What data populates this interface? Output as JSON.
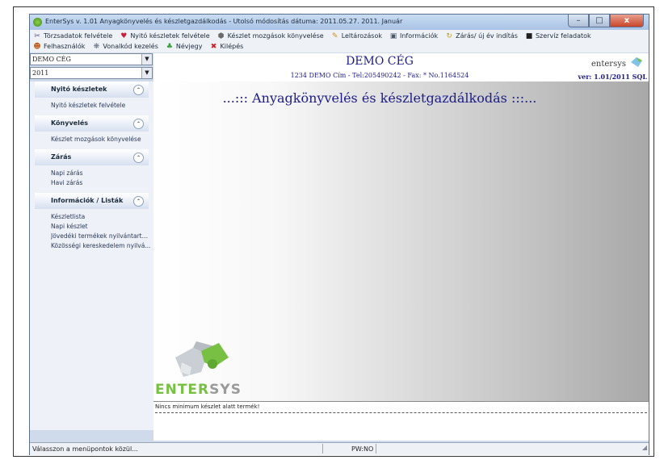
{
  "window": {
    "title": "EnterSys v. 1.01  Anyagkönyvelés és készletgazdálkodás - Utolsó módosítás dátuma: 2011.05.27.          2011. Január",
    "buttons": {
      "minimize": "–",
      "maximize": "□",
      "close": "x"
    }
  },
  "menu": {
    "row1": [
      {
        "icon": "tools-icon",
        "glyph": "✂",
        "color": "#5a4a8a",
        "label": "Törzsadatok felvétele"
      },
      {
        "icon": "stock-open-icon",
        "glyph": "♥",
        "color": "#c8203a",
        "label": "Nyitó készletek felvétele"
      },
      {
        "icon": "stock-movement-icon",
        "glyph": "⬢",
        "color": "#6a6a6a",
        "label": "Készlet mozgások könyvelése"
      },
      {
        "icon": "inventory-icon",
        "glyph": "✎",
        "color": "#d09020",
        "label": "Leltározások"
      },
      {
        "icon": "info-icon",
        "glyph": "▣",
        "color": "#4a5a6a",
        "label": "Információk"
      },
      {
        "icon": "close-year-icon",
        "glyph": "↻",
        "color": "#c0a020",
        "label": "Zárás/ új év indítás"
      },
      {
        "icon": "service-icon",
        "glyph": "■",
        "color": "#202020",
        "label": "Szervíz feladatok"
      }
    ],
    "row2": [
      {
        "icon": "users-icon",
        "glyph": "☻",
        "color": "#c06020",
        "label": "Felhasználók"
      },
      {
        "icon": "barcode-icon",
        "glyph": "❋",
        "color": "#607080",
        "label": "Vonalkód kezelés"
      },
      {
        "icon": "about-icon",
        "glyph": "♣",
        "color": "#30a030",
        "label": "Névjegy"
      },
      {
        "icon": "exit-icon",
        "glyph": "✖",
        "color": "#d02020",
        "label": "Kilépés"
      }
    ]
  },
  "selectors": {
    "company": "DEMO CÉG",
    "year": "2011"
  },
  "header": {
    "company": "DEMO CÉG",
    "address": "1234  DEMO Cím - Tel:205490242 - Fax: * No.1164524",
    "brand": "entersys",
    "version": "ver: 1.01/2011 SQL"
  },
  "sidebar": {
    "groups": [
      {
        "title": "Nyitó készletek",
        "items": [
          "Nyitó készletek felvétele"
        ]
      },
      {
        "title": "Könyvelés",
        "items": [
          "Készlet mozgások könyvelése"
        ]
      },
      {
        "title": "Zárás",
        "items": [
          "Napi zárás",
          "Havi zárás"
        ]
      },
      {
        "title": "Információk / Listák",
        "items": [
          "Készletlista",
          "Napi készlet",
          "Jövedéki termékek nyilvántartá...",
          "Közösségi kereskedelem nyilvá..."
        ]
      }
    ]
  },
  "main": {
    "heading": "...::: Anyagkönyvelés és készletgazdálkodás :::...",
    "logo_part1": "ENTER",
    "logo_part2": "SYS"
  },
  "messages": [
    "Nincs minimum készlet alatt termék!"
  ],
  "status": {
    "left": "Válasszon a menüpontok közül...",
    "mid": "PW:NO"
  },
  "colors": {
    "accent": "#1c1c8a",
    "brand_green": "#78c043",
    "brand_gray": "#9a9a9a"
  }
}
